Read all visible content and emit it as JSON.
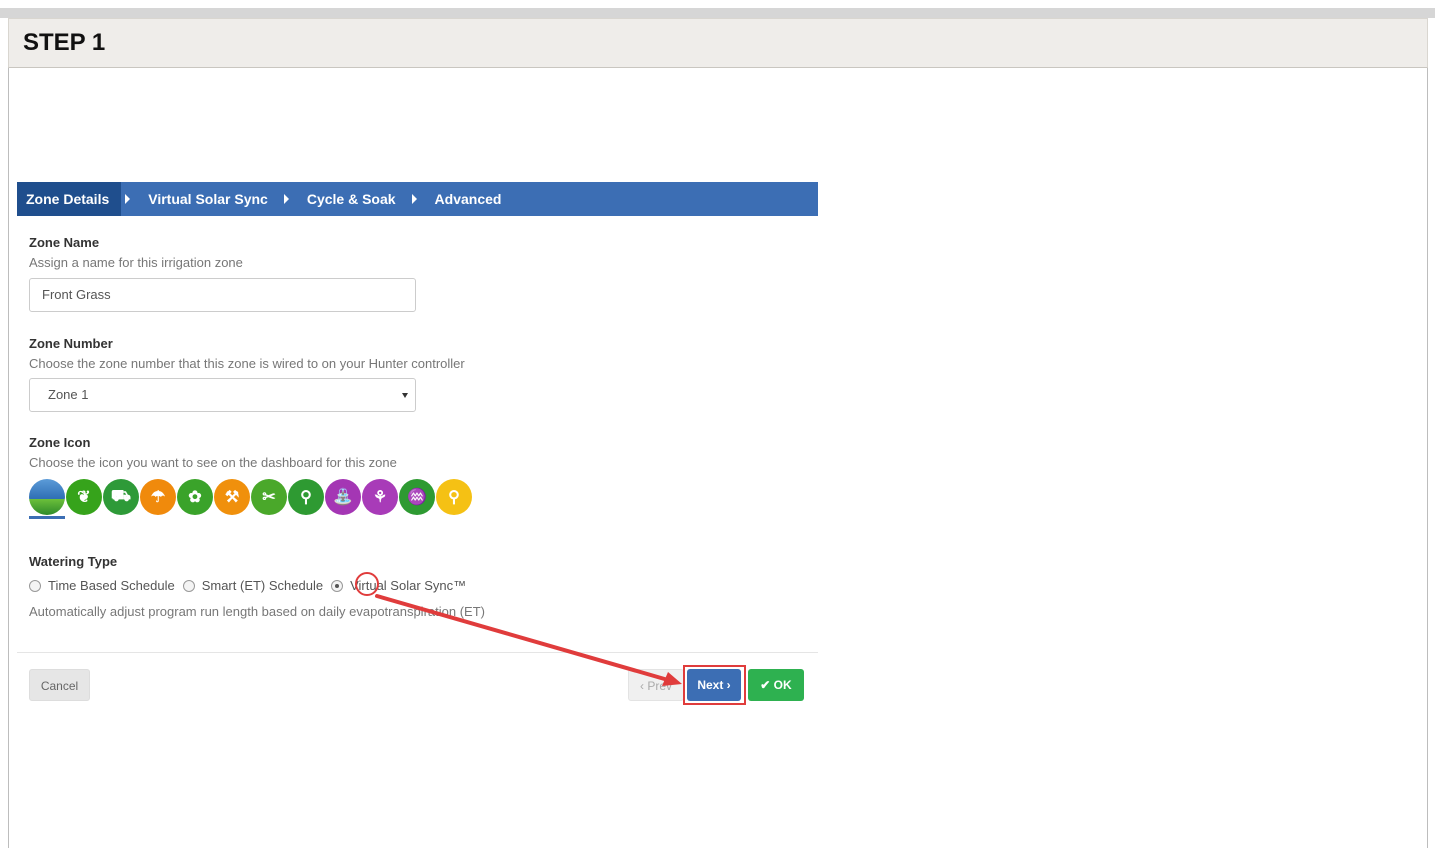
{
  "step": {
    "title": "STEP 1"
  },
  "tabs": [
    {
      "label": "Zone Details"
    },
    {
      "label": "Virtual Solar Sync"
    },
    {
      "label": "Cycle & Soak"
    },
    {
      "label": "Advanced"
    }
  ],
  "zone_name": {
    "title": "Zone Name",
    "description": "Assign a name for this irrigation zone",
    "value": "Front Grass"
  },
  "zone_number": {
    "title": "Zone Number",
    "description": "Choose the zone number that this zone is wired to on your Hunter controller",
    "value": "Zone 1"
  },
  "zone_icon": {
    "title": "Zone Icon",
    "description": "Choose the icon you want to see on the dashboard for this zone",
    "icons": [
      {
        "name": "lawn-icon",
        "color": "#2f6fb5",
        "glyph": ""
      },
      {
        "name": "leaf-icon",
        "color": "#36a31b",
        "glyph": "❦"
      },
      {
        "name": "wheelbarrow-icon",
        "color": "#2e9a38",
        "glyph": "⛟"
      },
      {
        "name": "watering-can-icon",
        "color": "#f08a0c",
        "glyph": "☂"
      },
      {
        "name": "flower-icon",
        "color": "#3aa32a",
        "glyph": "✿"
      },
      {
        "name": "rake-icon",
        "color": "#f0900c",
        "glyph": "⚒"
      },
      {
        "name": "shears-icon",
        "color": "#4aa82a",
        "glyph": "✂"
      },
      {
        "name": "shovel-icon",
        "color": "#2e9a32",
        "glyph": "⚲"
      },
      {
        "name": "sprayer-icon",
        "color": "#a436b4",
        "glyph": "⛲"
      },
      {
        "name": "sprout-icon",
        "color": "#a83bb8",
        "glyph": "⚘"
      },
      {
        "name": "grass-icon",
        "color": "#2e9a32",
        "glyph": "♒"
      },
      {
        "name": "tree-icon",
        "color": "#f5c114",
        "glyph": "⚲"
      }
    ]
  },
  "watering_type": {
    "title": "Watering Type",
    "options": [
      {
        "label": "Time Based Schedule",
        "checked": false
      },
      {
        "label": "Smart (ET) Schedule",
        "checked": false
      },
      {
        "label": "Virtual Solar Sync™",
        "checked": true
      }
    ],
    "description": "Automatically adjust program run length based on daily evapotranspiration (ET)"
  },
  "buttons": {
    "cancel": "Cancel",
    "prev": "‹ Prev",
    "next": "Next ›",
    "ok": "✔ OK"
  },
  "colors": {
    "tab_bar": "#3c6eb4",
    "tab_active": "#1f4e8d",
    "next_button": "#3c6eb4",
    "ok_button": "#2eb150",
    "annotation": "#e03c3c"
  }
}
